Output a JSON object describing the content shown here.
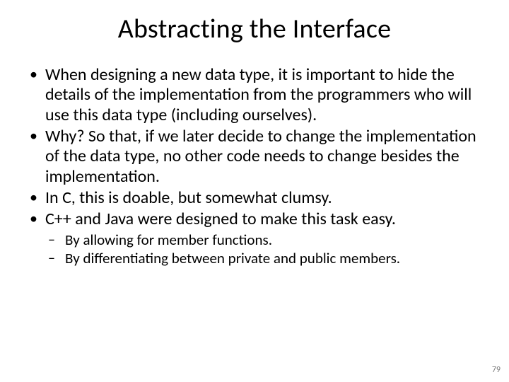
{
  "title": "Abstracting the Interface",
  "bullets": [
    "When designing a new data type, it is important to hide the details of the implementation from the programmers who will use this data type (including ourselves).",
    "Why? So that, if we later decide to change the implementation of the data type, no other code needs to change besides the implementation.",
    "In C, this is doable, but somewhat clumsy.",
    "C++ and Java were designed to make this task easy."
  ],
  "sub_bullets": [
    "By allowing for member functions.",
    "By differentiating between private and public members."
  ],
  "page_number": "79"
}
